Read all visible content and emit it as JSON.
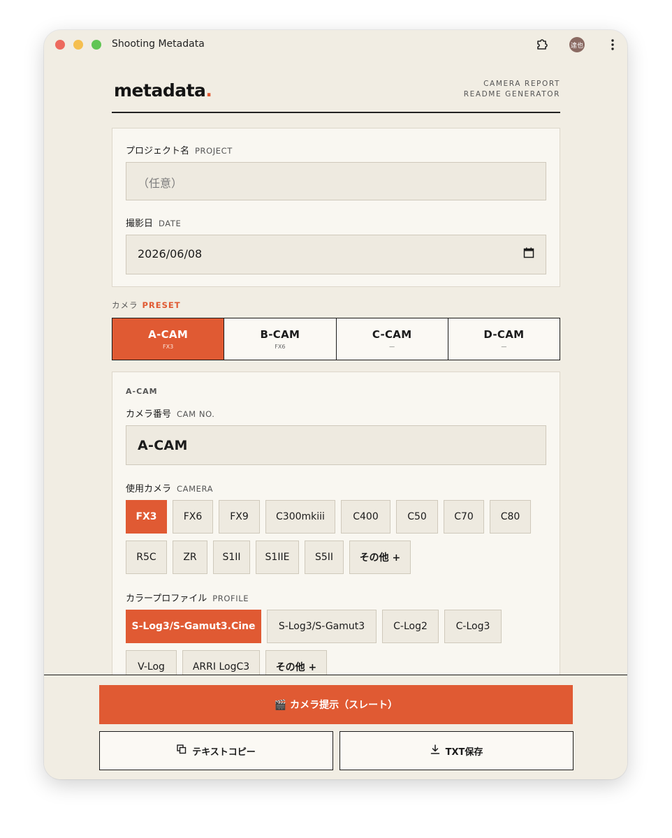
{
  "window": {
    "title": "Shooting Metadata",
    "avatar_text": "達也"
  },
  "brand": {
    "logo": "metadata",
    "logo_dot": ".",
    "tagline_line1": "CAMERA REPORT",
    "tagline_line2": "README GENERATOR"
  },
  "project": {
    "label_ja": "プロジェクト名",
    "label_en": "PROJECT",
    "placeholder": "（任意）"
  },
  "date": {
    "label_ja": "撮影日",
    "label_en": "DATE",
    "value": "2026/06/08"
  },
  "camera_section": {
    "label_ja": "カメラ",
    "label_en": "PRESET"
  },
  "camera_tabs": [
    {
      "name": "A-CAM",
      "sub": "FX3",
      "active": true
    },
    {
      "name": "B-CAM",
      "sub": "FX6",
      "active": false
    },
    {
      "name": "C-CAM",
      "sub": "—",
      "active": false
    },
    {
      "name": "D-CAM",
      "sub": "—",
      "active": false
    }
  ],
  "cam_card": {
    "heading": "A-CAM",
    "cam_no": {
      "label_ja": "カメラ番号",
      "label_en": "CAM NO.",
      "value": "A-CAM"
    },
    "camera": {
      "label_ja": "使用カメラ",
      "label_en": "CAMERA",
      "options": [
        "FX3",
        "FX6",
        "FX9",
        "C300mkiii",
        "C400",
        "C50",
        "C70",
        "C80",
        "R5C",
        "ZR",
        "S1II",
        "S1IIE",
        "S5II",
        "その他 +"
      ],
      "selected": "FX3"
    },
    "profile": {
      "label_ja": "カラープロファイル",
      "label_en": "PROFILE",
      "options": [
        "S-Log3/S-Gamut3.Cine",
        "S-Log3/S-Gamut3",
        "C-Log2",
        "C-Log3",
        "V-Log",
        "ARRI LogC3",
        "その他 +"
      ],
      "selected": "S-Log3/S-Gamut3.Cine"
    }
  },
  "actions": {
    "slate": "🎬 カメラ提示（スレート）",
    "copy": "テキストコピー",
    "save": "TXT保存"
  },
  "colors": {
    "accent": "#e05a33",
    "background": "#f1ede3",
    "card": "#f9f7f1",
    "input": "#eeeae0"
  }
}
